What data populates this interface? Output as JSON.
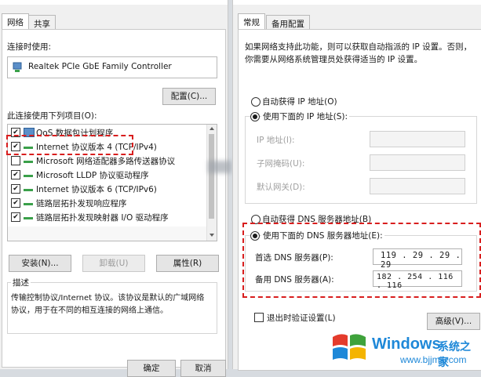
{
  "left": {
    "tabs": [
      "网络",
      "共享"
    ],
    "connect_using_label": "连接时使用:",
    "adapter_name": "Realtek PCIe GbE Family Controller",
    "configure_button": "配置(C)...",
    "items_label": "此连接使用下列项目(O):",
    "items": [
      {
        "label": "QoS 数据包计划程序",
        "checked": true
      },
      {
        "label": "Internet 协议版本 4 (TCP/IPv4)",
        "checked": true
      },
      {
        "label": "Microsoft 网络适配器多路传送器协议",
        "checked": false
      },
      {
        "label": "Microsoft LLDP 协议驱动程序",
        "checked": true
      },
      {
        "label": "Internet 协议版本 6 (TCP/IPv6)",
        "checked": true
      },
      {
        "label": "链路层拓扑发现响应程序",
        "checked": true
      },
      {
        "label": "链路层拓扑发现映射器 I/O 驱动程序",
        "checked": true
      }
    ],
    "install_button": "安装(N)...",
    "uninstall_button": "卸载(U)",
    "properties_button": "属性(R)",
    "description_label": "描述",
    "description_text": "传输控制协议/Internet 协议。该协议是默认的广域网络协议，用于在不同的相互连接的网络上通信。",
    "ok_button": "确定",
    "cancel_button": "取消"
  },
  "right": {
    "tabs": [
      "常规",
      "备用配置"
    ],
    "intro_text": "如果网络支持此功能，则可以获取自动指派的 IP 设置。否则，你需要从网络系统管理员处获得适当的 IP 设置。",
    "auto_ip_label": "自动获得 IP 地址(O)",
    "manual_ip_label": "使用下面的 IP 地址(S):",
    "ip_address_label": "IP 地址(I):",
    "subnet_label": "子网掩码(U):",
    "gateway_label": "默认网关(D):",
    "auto_dns_label": "自动获得 DNS 服务器地址(B)",
    "manual_dns_label": "使用下面的 DNS 服务器地址(E):",
    "preferred_dns_label": "首选 DNS 服务器(P):",
    "preferred_dns_value": "119 . 29 . 29 . 29",
    "alternate_dns_label": "备用 DNS 服务器(A):",
    "alternate_dns_value": "182 . 254 . 116 . 116",
    "validate_label": "退出时验证设置(L)",
    "advanced_button": "高级(V)..."
  },
  "watermark": {
    "title": "Windows",
    "subtitle": "系统之家",
    "url": "www.bjjmlv.com"
  },
  "colors": {
    "highlight": "#d81e1e",
    "win_blue": "#1e88d8"
  }
}
